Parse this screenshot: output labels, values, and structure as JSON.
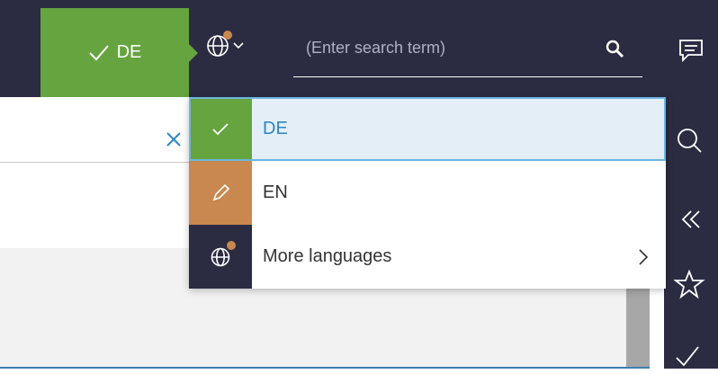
{
  "header": {
    "active_language": "DE",
    "search": {
      "placeholder": "(Enter search term)",
      "value": ""
    }
  },
  "language_menu": {
    "items": [
      {
        "label": "DE",
        "state": "selected",
        "icon": "check-icon",
        "color": "#66a43f"
      },
      {
        "label": "EN",
        "state": "edit",
        "icon": "pencil-icon",
        "color": "#c8884f"
      },
      {
        "label": "More languages",
        "state": "submenu",
        "icon": "globe-icon",
        "color": "#2b2c42"
      }
    ]
  },
  "rail_icons": [
    "chat-icon",
    "search-icon",
    "double-chevron-left-icon",
    "star-icon",
    "check-icon"
  ],
  "colors": {
    "topbar": "#2b2c42",
    "accent_green": "#66a43f",
    "accent_orange": "#c8884f",
    "selection_border": "#69b7e0",
    "link_blue": "#2d86c2"
  }
}
